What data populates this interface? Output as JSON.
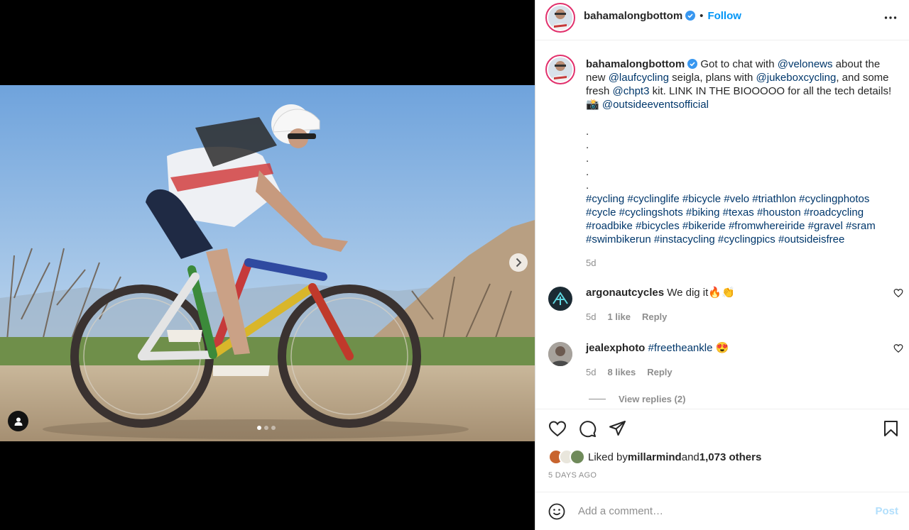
{
  "post": {
    "username": "bahamalongbottom",
    "separator": "•",
    "follow_label": "Follow",
    "more_icon": "more-horizontal-icon",
    "verified_color": "#3897f0"
  },
  "caption": {
    "username": "bahamalongbottom",
    "t1": "Got to chat with ",
    "m1": "@velonews",
    "t2": " about the new ",
    "m2": "@laufcycling",
    "t3": " seigla, plans with ",
    "m3": "@jukeboxcycling",
    "t4": ", and some fresh ",
    "m4": "@chpt3",
    "t5": " kit. LINK IN THE BIOOOOO for all the tech details!",
    "camera": "📸",
    "m5": "@outsideeventsofficial",
    "dots": [
      ".",
      ".",
      ".",
      ".",
      "."
    ],
    "hashtags": "#cycling #cyclinglife #bicycle #velo #triathlon #cyclingphotos #cycle #cyclingshots #biking #texas #houston #roadcycling #roadbike #bicycles #bikeride #fromwhereiride #gravel #sram #swimbikerun #instacycling #cyclingpics #outsideisfree",
    "time": "5d"
  },
  "comments": [
    {
      "username": "argonautcycles",
      "text": "We dig it🔥👏",
      "time": "5d",
      "likes": "1 like",
      "reply": "Reply"
    },
    {
      "username": "jealexphoto",
      "mention": "#freetheankle",
      "emoji": "😍",
      "time": "5d",
      "likes": "8 likes",
      "reply": "Reply"
    }
  ],
  "view_replies": "View replies (2)",
  "likes": {
    "prefix": "Liked by ",
    "user": "millarmind",
    "mid": " and ",
    "count": "1,073 others"
  },
  "posted_ago": "5 DAYS AGO",
  "add_comment": {
    "placeholder": "Add a comment…",
    "post_label": "Post"
  },
  "carousel": {
    "total": 3,
    "active": 1
  },
  "colors": {
    "link": "#00376b",
    "follow": "#0095f6",
    "muted": "#8e8e8e",
    "post_disabled": "#b2dffc"
  }
}
